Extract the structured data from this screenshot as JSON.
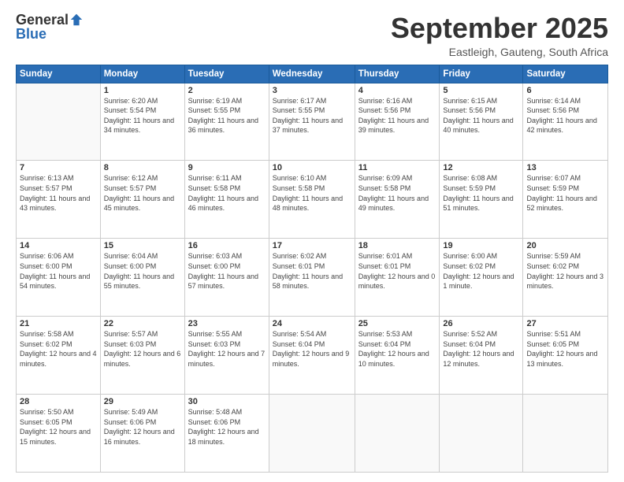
{
  "logo": {
    "general": "General",
    "blue": "Blue"
  },
  "header": {
    "month": "September 2025",
    "location": "Eastleigh, Gauteng, South Africa"
  },
  "days_of_week": [
    "Sunday",
    "Monday",
    "Tuesday",
    "Wednesday",
    "Thursday",
    "Friday",
    "Saturday"
  ],
  "weeks": [
    [
      {
        "day": "",
        "sunrise": "",
        "sunset": "",
        "daylight": ""
      },
      {
        "day": "1",
        "sunrise": "Sunrise: 6:20 AM",
        "sunset": "Sunset: 5:54 PM",
        "daylight": "Daylight: 11 hours and 34 minutes."
      },
      {
        "day": "2",
        "sunrise": "Sunrise: 6:19 AM",
        "sunset": "Sunset: 5:55 PM",
        "daylight": "Daylight: 11 hours and 36 minutes."
      },
      {
        "day": "3",
        "sunrise": "Sunrise: 6:17 AM",
        "sunset": "Sunset: 5:55 PM",
        "daylight": "Daylight: 11 hours and 37 minutes."
      },
      {
        "day": "4",
        "sunrise": "Sunrise: 6:16 AM",
        "sunset": "Sunset: 5:56 PM",
        "daylight": "Daylight: 11 hours and 39 minutes."
      },
      {
        "day": "5",
        "sunrise": "Sunrise: 6:15 AM",
        "sunset": "Sunset: 5:56 PM",
        "daylight": "Daylight: 11 hours and 40 minutes."
      },
      {
        "day": "6",
        "sunrise": "Sunrise: 6:14 AM",
        "sunset": "Sunset: 5:56 PM",
        "daylight": "Daylight: 11 hours and 42 minutes."
      }
    ],
    [
      {
        "day": "7",
        "sunrise": "Sunrise: 6:13 AM",
        "sunset": "Sunset: 5:57 PM",
        "daylight": "Daylight: 11 hours and 43 minutes."
      },
      {
        "day": "8",
        "sunrise": "Sunrise: 6:12 AM",
        "sunset": "Sunset: 5:57 PM",
        "daylight": "Daylight: 11 hours and 45 minutes."
      },
      {
        "day": "9",
        "sunrise": "Sunrise: 6:11 AM",
        "sunset": "Sunset: 5:58 PM",
        "daylight": "Daylight: 11 hours and 46 minutes."
      },
      {
        "day": "10",
        "sunrise": "Sunrise: 6:10 AM",
        "sunset": "Sunset: 5:58 PM",
        "daylight": "Daylight: 11 hours and 48 minutes."
      },
      {
        "day": "11",
        "sunrise": "Sunrise: 6:09 AM",
        "sunset": "Sunset: 5:58 PM",
        "daylight": "Daylight: 11 hours and 49 minutes."
      },
      {
        "day": "12",
        "sunrise": "Sunrise: 6:08 AM",
        "sunset": "Sunset: 5:59 PM",
        "daylight": "Daylight: 11 hours and 51 minutes."
      },
      {
        "day": "13",
        "sunrise": "Sunrise: 6:07 AM",
        "sunset": "Sunset: 5:59 PM",
        "daylight": "Daylight: 11 hours and 52 minutes."
      }
    ],
    [
      {
        "day": "14",
        "sunrise": "Sunrise: 6:06 AM",
        "sunset": "Sunset: 6:00 PM",
        "daylight": "Daylight: 11 hours and 54 minutes."
      },
      {
        "day": "15",
        "sunrise": "Sunrise: 6:04 AM",
        "sunset": "Sunset: 6:00 PM",
        "daylight": "Daylight: 11 hours and 55 minutes."
      },
      {
        "day": "16",
        "sunrise": "Sunrise: 6:03 AM",
        "sunset": "Sunset: 6:00 PM",
        "daylight": "Daylight: 11 hours and 57 minutes."
      },
      {
        "day": "17",
        "sunrise": "Sunrise: 6:02 AM",
        "sunset": "Sunset: 6:01 PM",
        "daylight": "Daylight: 11 hours and 58 minutes."
      },
      {
        "day": "18",
        "sunrise": "Sunrise: 6:01 AM",
        "sunset": "Sunset: 6:01 PM",
        "daylight": "Daylight: 12 hours and 0 minutes."
      },
      {
        "day": "19",
        "sunrise": "Sunrise: 6:00 AM",
        "sunset": "Sunset: 6:02 PM",
        "daylight": "Daylight: 12 hours and 1 minute."
      },
      {
        "day": "20",
        "sunrise": "Sunrise: 5:59 AM",
        "sunset": "Sunset: 6:02 PM",
        "daylight": "Daylight: 12 hours and 3 minutes."
      }
    ],
    [
      {
        "day": "21",
        "sunrise": "Sunrise: 5:58 AM",
        "sunset": "Sunset: 6:02 PM",
        "daylight": "Daylight: 12 hours and 4 minutes."
      },
      {
        "day": "22",
        "sunrise": "Sunrise: 5:57 AM",
        "sunset": "Sunset: 6:03 PM",
        "daylight": "Daylight: 12 hours and 6 minutes."
      },
      {
        "day": "23",
        "sunrise": "Sunrise: 5:55 AM",
        "sunset": "Sunset: 6:03 PM",
        "daylight": "Daylight: 12 hours and 7 minutes."
      },
      {
        "day": "24",
        "sunrise": "Sunrise: 5:54 AM",
        "sunset": "Sunset: 6:04 PM",
        "daylight": "Daylight: 12 hours and 9 minutes."
      },
      {
        "day": "25",
        "sunrise": "Sunrise: 5:53 AM",
        "sunset": "Sunset: 6:04 PM",
        "daylight": "Daylight: 12 hours and 10 minutes."
      },
      {
        "day": "26",
        "sunrise": "Sunrise: 5:52 AM",
        "sunset": "Sunset: 6:04 PM",
        "daylight": "Daylight: 12 hours and 12 minutes."
      },
      {
        "day": "27",
        "sunrise": "Sunrise: 5:51 AM",
        "sunset": "Sunset: 6:05 PM",
        "daylight": "Daylight: 12 hours and 13 minutes."
      }
    ],
    [
      {
        "day": "28",
        "sunrise": "Sunrise: 5:50 AM",
        "sunset": "Sunset: 6:05 PM",
        "daylight": "Daylight: 12 hours and 15 minutes."
      },
      {
        "day": "29",
        "sunrise": "Sunrise: 5:49 AM",
        "sunset": "Sunset: 6:06 PM",
        "daylight": "Daylight: 12 hours and 16 minutes."
      },
      {
        "day": "30",
        "sunrise": "Sunrise: 5:48 AM",
        "sunset": "Sunset: 6:06 PM",
        "daylight": "Daylight: 12 hours and 18 minutes."
      },
      {
        "day": "",
        "sunrise": "",
        "sunset": "",
        "daylight": ""
      },
      {
        "day": "",
        "sunrise": "",
        "sunset": "",
        "daylight": ""
      },
      {
        "day": "",
        "sunrise": "",
        "sunset": "",
        "daylight": ""
      },
      {
        "day": "",
        "sunrise": "",
        "sunset": "",
        "daylight": ""
      }
    ]
  ]
}
